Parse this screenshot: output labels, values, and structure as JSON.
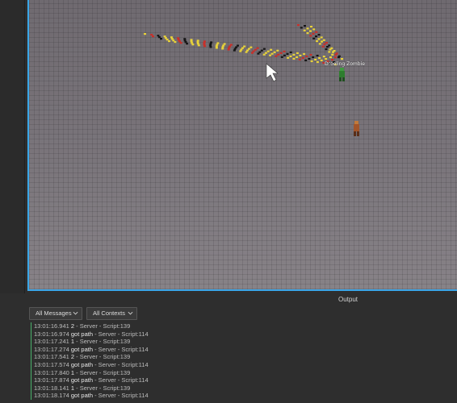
{
  "viewport": {
    "npc_label": "Drooling Zombie"
  },
  "output_panel": {
    "title": "Output",
    "filters": {
      "messages": "All Messages",
      "contexts": "All Contexts"
    },
    "rows": [
      {
        "time": "13:01:16.941",
        "message": "2",
        "source": "Server - Script:139"
      },
      {
        "time": "13:01:16.974",
        "message": "got path",
        "source": "Server - Script:114"
      },
      {
        "time": "13:01:17.241",
        "message": "1",
        "source": "Server - Script:139"
      },
      {
        "time": "13:01:17.274",
        "message": "got path",
        "source": "Server - Script:114"
      },
      {
        "time": "13:01:17.541",
        "message": "2",
        "source": "Server - Script:139"
      },
      {
        "time": "13:01:17.574",
        "message": "got path",
        "source": "Server - Script:114"
      },
      {
        "time": "13:01:17.840",
        "message": "1",
        "source": "Server - Script:139"
      },
      {
        "time": "13:01:17.874",
        "message": "got path",
        "source": "Server - Script:114"
      },
      {
        "time": "13:01:18.141",
        "message": "1",
        "source": "Server - Script:139"
      },
      {
        "time": "13:01:18.174",
        "message": "got path",
        "source": "Server - Script:114"
      }
    ]
  },
  "colors": {
    "selection_outline": "#3aa6e8",
    "log_marker": "#49b26b",
    "waypoint_yellow": "#e8d23a",
    "waypoint_red": "#c8302a",
    "waypoint_black": "#151515"
  }
}
